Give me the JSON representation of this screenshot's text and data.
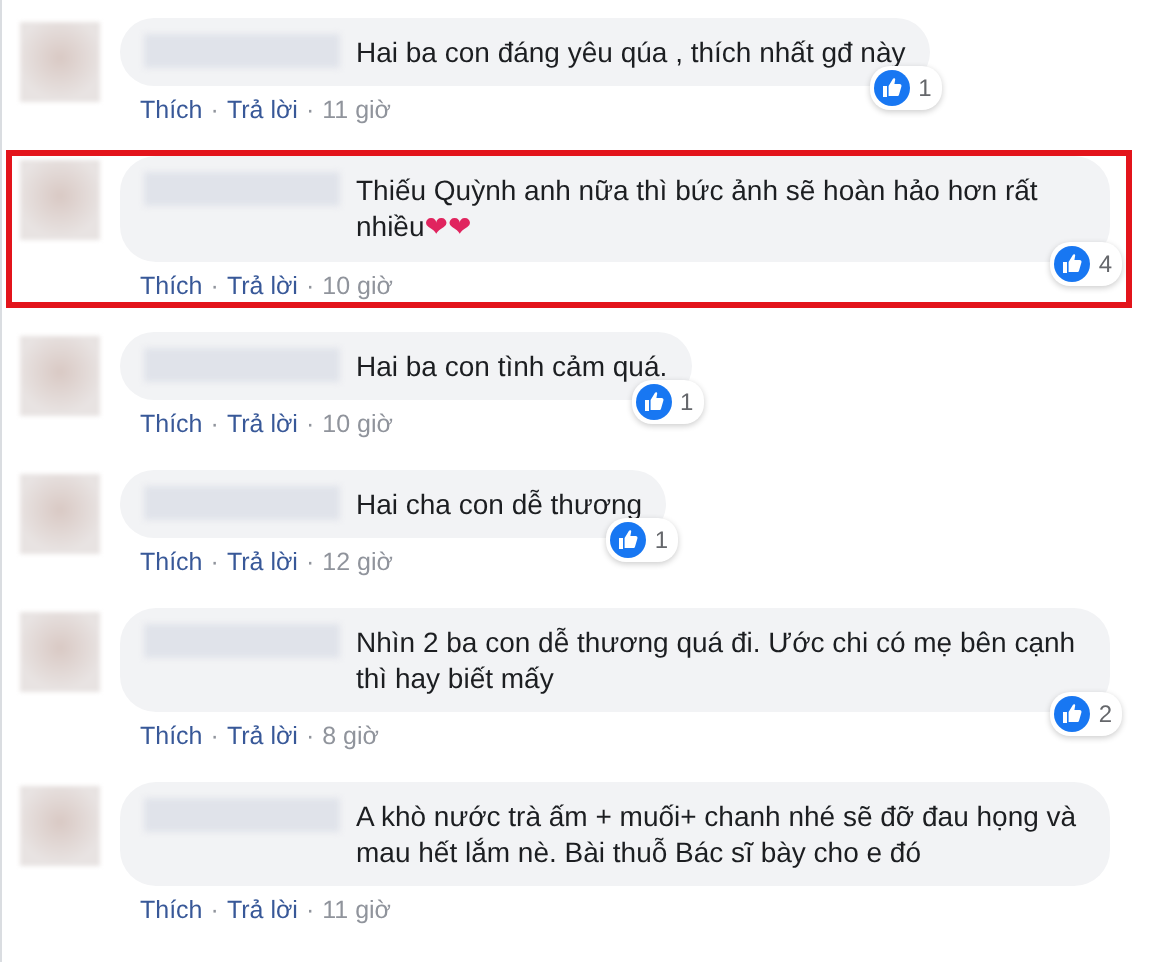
{
  "comments": [
    {
      "highlighted": false,
      "text": "Hai ba con đáng yêu qúa , thích nhất gđ này",
      "reactions": "1",
      "meta": [
        {
          "kind": "link",
          "text": "Thích"
        },
        {
          "kind": "sep",
          "text": "·"
        },
        {
          "kind": "link",
          "text": "Trả lời"
        },
        {
          "kind": "sep",
          "text": "·"
        },
        {
          "kind": "time",
          "text": "11 giờ"
        }
      ]
    },
    {
      "highlighted": true,
      "text": "Thiếu Quỳnh anh nữa thì bức ảnh sẽ hoàn hảo hơn rất nhiều",
      "emoji": "❤❤",
      "reactions": "4",
      "meta": [
        {
          "kind": "link",
          "text": "Thích"
        },
        {
          "kind": "sep",
          "text": "·"
        },
        {
          "kind": "link",
          "text": "Trả lời"
        },
        {
          "kind": "sep",
          "text": "·"
        },
        {
          "kind": "time",
          "text": "10 giờ"
        }
      ]
    },
    {
      "highlighted": false,
      "text": "Hai ba con tình cảm quá.",
      "reactions": "1",
      "meta": [
        {
          "kind": "link",
          "text": "Thích"
        },
        {
          "kind": "sep",
          "text": "·"
        },
        {
          "kind": "link",
          "text": "Trả lời"
        },
        {
          "kind": "sep",
          "text": "·"
        },
        {
          "kind": "time",
          "text": "10 giờ"
        }
      ]
    },
    {
      "highlighted": false,
      "text": "Hai cha con dễ thương",
      "reactions": "1",
      "meta": [
        {
          "kind": "link",
          "text": "Thích"
        },
        {
          "kind": "sep",
          "text": "·"
        },
        {
          "kind": "link",
          "text": "Trả lời"
        },
        {
          "kind": "sep",
          "text": "·"
        },
        {
          "kind": "time",
          "text": "12 giờ"
        }
      ]
    },
    {
      "highlighted": false,
      "text": "Nhìn 2 ba con dễ thương quá đi. Ước chi có mẹ bên cạnh thì hay biết mấy",
      "reactions": "2",
      "meta": [
        {
          "kind": "link",
          "text": "Thích"
        },
        {
          "kind": "sep",
          "text": "·"
        },
        {
          "kind": "link",
          "text": "Trả lời"
        },
        {
          "kind": "sep",
          "text": "·"
        },
        {
          "kind": "time",
          "text": "8 giờ"
        }
      ]
    },
    {
      "highlighted": false,
      "text": "A khò nước trà ấm + muối+ chanh nhé sẽ đỡ đau họng và mau hết lắm nè. Bài thuỗ Bác sĩ bày cho e đó",
      "meta": [
        {
          "kind": "link",
          "text": "Thích"
        },
        {
          "kind": "sep",
          "text": "·"
        },
        {
          "kind": "link",
          "text": "Trả lời"
        },
        {
          "kind": "sep",
          "text": "·"
        },
        {
          "kind": "time",
          "text": "11 giờ"
        }
      ]
    }
  ]
}
